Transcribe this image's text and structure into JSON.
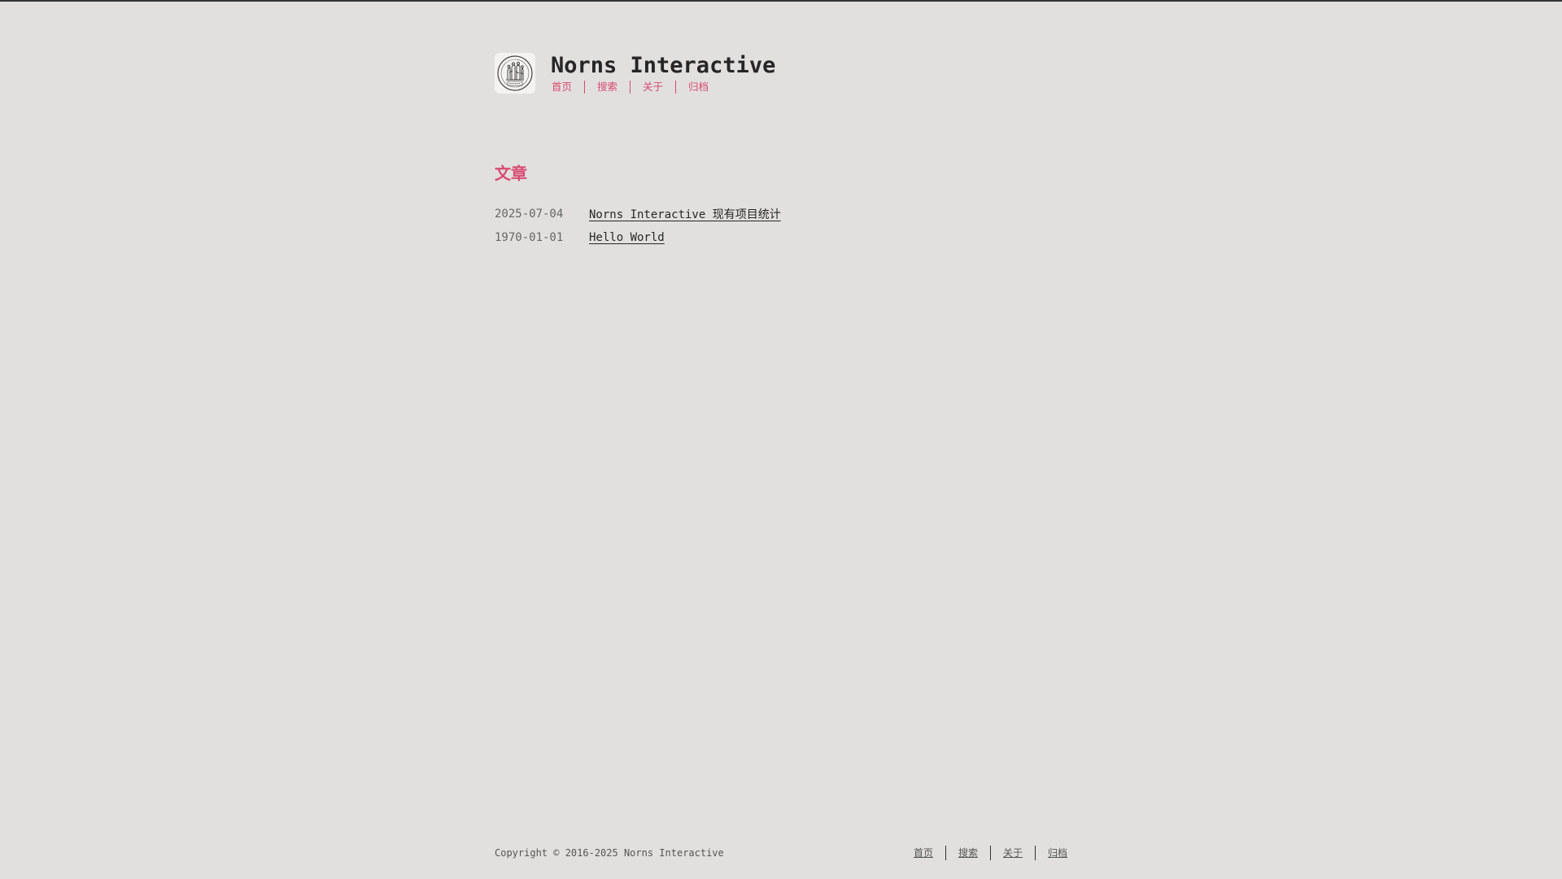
{
  "site": {
    "title": "Norns Interactive",
    "logo_icon": "seal-logo-icon"
  },
  "nav": {
    "items": [
      {
        "label": "首页"
      },
      {
        "label": "搜索"
      },
      {
        "label": "关于"
      },
      {
        "label": "归档"
      }
    ]
  },
  "main": {
    "section_title": "文章",
    "posts": [
      {
        "date": "2025-07-04",
        "title": "Norns Interactive 现有项目统计"
      },
      {
        "date": "1970-01-01",
        "title": "Hello World"
      }
    ]
  },
  "footer": {
    "copyright": "Copyright © 2016-2025 Norns Interactive",
    "nav": [
      {
        "label": "首页"
      },
      {
        "label": "搜索"
      },
      {
        "label": "关于"
      },
      {
        "label": "归档"
      }
    ]
  },
  "colors": {
    "accent": "#d94a72",
    "background": "#e1e0de",
    "text": "#262626"
  }
}
